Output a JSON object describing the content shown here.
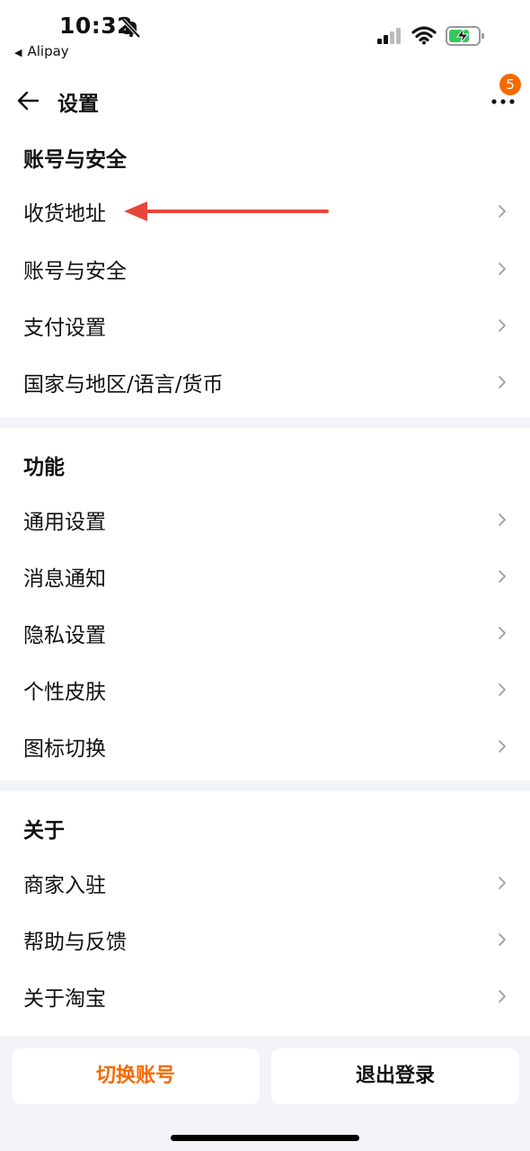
{
  "status_bar": {
    "time": "10:32",
    "back_app": "Alipay",
    "battery_color": "#34c759"
  },
  "header": {
    "title": "设置",
    "badge_count": "5"
  },
  "sections": [
    {
      "title": "账号与安全",
      "items": [
        {
          "label": "收货地址"
        },
        {
          "label": "账号与安全"
        },
        {
          "label": "支付设置"
        },
        {
          "label": "国家与地区/语言/货币"
        }
      ]
    },
    {
      "title": "功能",
      "items": [
        {
          "label": "通用设置"
        },
        {
          "label": "消息通知"
        },
        {
          "label": "隐私设置"
        },
        {
          "label": "个性皮肤"
        },
        {
          "label": "图标切换"
        }
      ]
    },
    {
      "title": "关于",
      "items": [
        {
          "label": "商家入驻"
        },
        {
          "label": "帮助与反馈"
        },
        {
          "label": "关于淘宝"
        }
      ]
    }
  ],
  "footer": {
    "switch_account": "切换账号",
    "logout": "退出登录"
  },
  "colors": {
    "accent": "#f56a00",
    "annotation_arrow": "#e5483a",
    "background": "#f3f4f8"
  }
}
